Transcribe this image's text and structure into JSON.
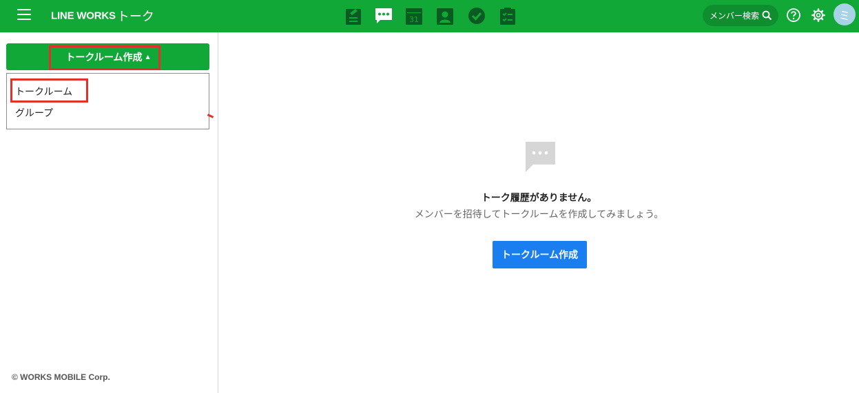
{
  "header": {
    "brand_logo": "LINE WORKS",
    "brand_service": "トーク",
    "apps": [
      {
        "name": "board",
        "icon": "board-icon"
      },
      {
        "name": "talk",
        "icon": "chat-icon"
      },
      {
        "name": "calendar",
        "icon": "calendar-icon",
        "label": "31"
      },
      {
        "name": "contacts",
        "icon": "contact-icon"
      },
      {
        "name": "task",
        "icon": "check-circle-icon"
      },
      {
        "name": "survey",
        "icon": "checklist-icon"
      }
    ],
    "member_search_label": "メンバー検索",
    "avatar_initial": "ミ"
  },
  "sidebar": {
    "create_button_label": "トークルーム作成",
    "create_button_caret": "▲",
    "dropdown_items": [
      {
        "label": "トークルーム"
      },
      {
        "label": "グループ"
      }
    ],
    "copyright": "© WORKS MOBILE Corp."
  },
  "main": {
    "empty_title": "トーク履歴がありません。",
    "empty_description": "メンバーを招待してトークルームを作成してみましょう。",
    "create_button_label": "トークルーム作成"
  },
  "colors": {
    "header_green": "#12a838",
    "search_pill_green": "#0f8e2f",
    "app_icon_dark_green": "#0a5b22",
    "highlight_red": "#e3302a",
    "primary_blue": "#1a7ef0",
    "avatar_bg": "#a8d3e6"
  }
}
